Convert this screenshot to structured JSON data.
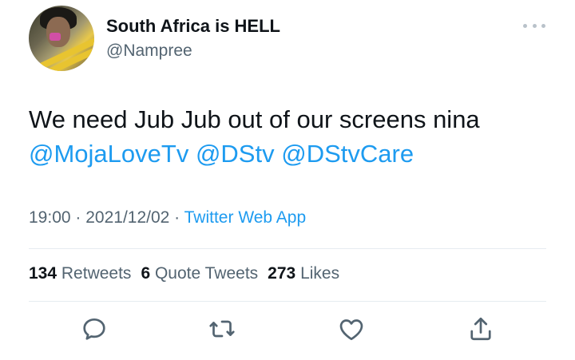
{
  "author": {
    "display_name": "South Africa is HELL",
    "handle": "@Nampree"
  },
  "tweet": {
    "text_line1": "We need Jub Jub out of our screens nina",
    "mentions": [
      "@MojaLoveTv",
      "@DStv",
      "@DStvCare"
    ],
    "time": "19:00",
    "date": "2021/12/02",
    "source": "Twitter Web App",
    "separator": " · "
  },
  "stats": {
    "retweets_count": "134",
    "retweets_label": "Retweets",
    "quotes_count": "6",
    "quotes_label": "Quote Tweets",
    "likes_count": "273",
    "likes_label": "Likes"
  },
  "actions": {
    "reply_icon": "reply-icon",
    "retweet_icon": "retweet-icon",
    "like_icon": "heart-icon",
    "share_icon": "share-icon"
  },
  "colors": {
    "accent": "#1d9bf0",
    "text": "#0f1419",
    "muted": "#536471",
    "divider": "#e6ecf0"
  }
}
